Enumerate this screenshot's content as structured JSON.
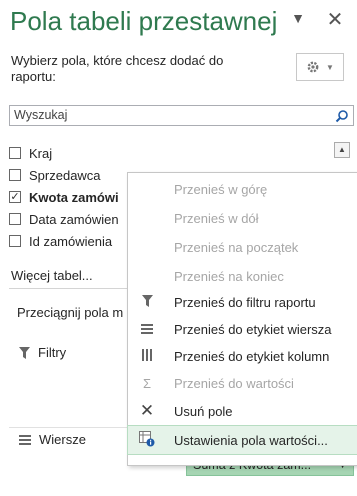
{
  "header": {
    "title": "Pola tabeli przestawnej",
    "subtitle": "Wybierz pola, które chcesz dodać do raportu:"
  },
  "search": {
    "placeholder": "Wyszukaj"
  },
  "fields": [
    {
      "label": "Kraj",
      "checked": false
    },
    {
      "label": "Sprzedawca",
      "checked": false
    },
    {
      "label": "Kwota zamówi",
      "checked": true
    },
    {
      "label": "Data zamówien",
      "checked": false
    },
    {
      "label": "Id zamówienia",
      "checked": false
    }
  ],
  "more_tables": "Więcej tabel...",
  "drag_hint": "Przeciągnij pola m",
  "areas": {
    "filters_label": "Filtry",
    "rows_label": "Wiersze",
    "values_item": "Suma z Kwota zam..."
  },
  "context_menu": {
    "items": [
      {
        "label": "Przenieś w górę",
        "enabled": false,
        "icon": ""
      },
      {
        "label": "Przenieś w dół",
        "enabled": false,
        "icon": ""
      },
      {
        "label": "Przenieś na początek",
        "enabled": false,
        "icon": ""
      },
      {
        "label": "Przenieś na koniec",
        "enabled": false,
        "icon": ""
      },
      {
        "label": "Przenieś do filtru raportu",
        "enabled": true,
        "icon": "filter-icon"
      },
      {
        "label": "Przenieś do etykiet wiersza",
        "enabled": true,
        "icon": "rows-icon"
      },
      {
        "label": "Przenieś do etykiet kolumn",
        "enabled": true,
        "icon": "columns-icon"
      },
      {
        "label": "Przenieś do wartości",
        "enabled": false,
        "icon": "sigma-icon"
      },
      {
        "label": "Usuń pole",
        "enabled": true,
        "icon": "close-x-icon"
      },
      {
        "label": "Ustawienia pola wartości...",
        "enabled": true,
        "icon": "field-settings-icon",
        "highlighted": true
      }
    ]
  },
  "colors": {
    "title": "#2f7a4f",
    "highlight": "#e5f3e9",
    "pill": "#a6d5b3"
  }
}
